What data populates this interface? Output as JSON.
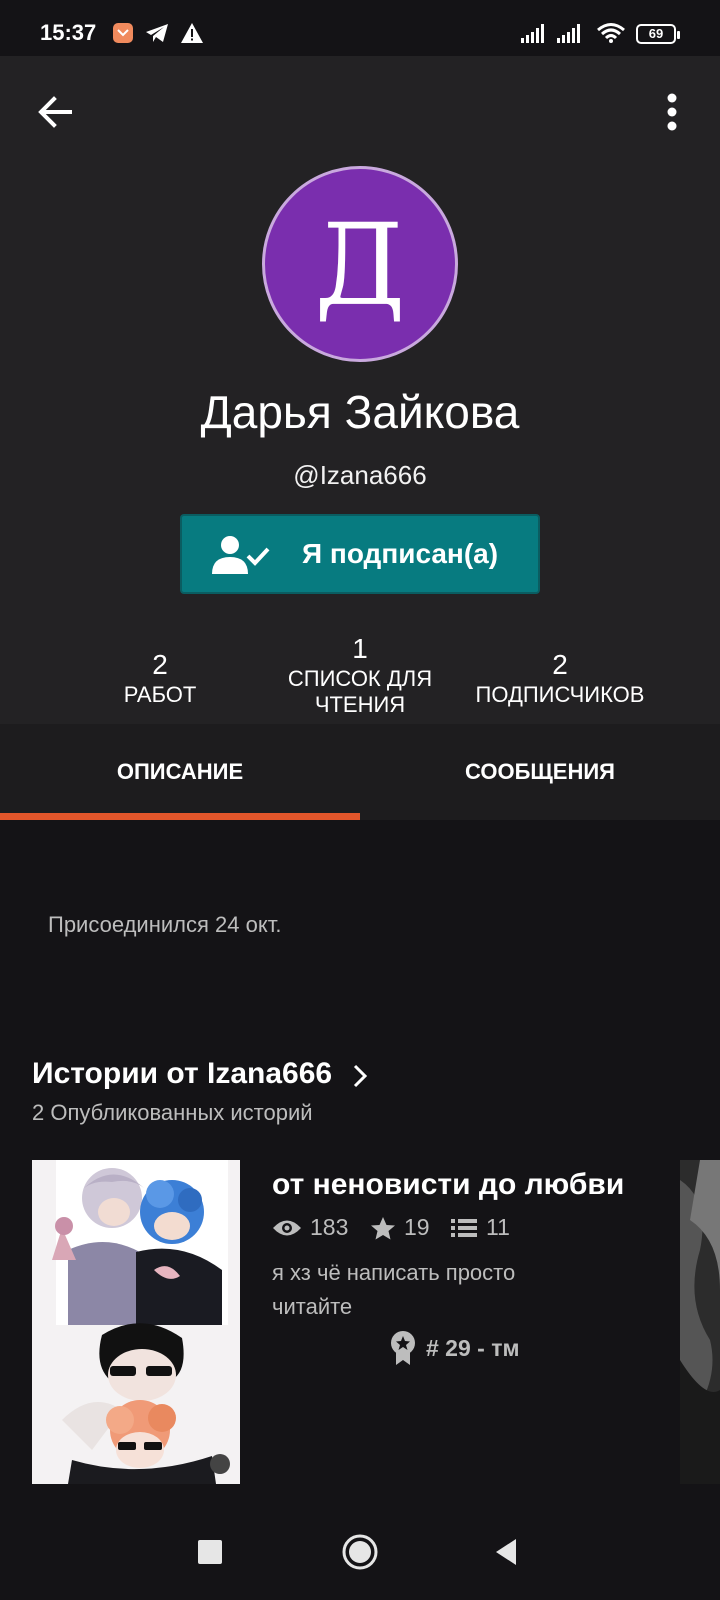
{
  "status_bar": {
    "time": "15:37",
    "battery": "69"
  },
  "profile": {
    "avatar_letter": "Д",
    "avatar_color": "#7a2eae",
    "name": "Дарья Зайкова",
    "username": "@Izana666",
    "follow_button_label": "Я подписан(а)",
    "follow_button_color": "#077b80"
  },
  "stats": [
    {
      "value": "2",
      "label": "РАБОТ"
    },
    {
      "value": "1",
      "label": "СПИСОК ДЛЯ ЧТЕНИЯ"
    },
    {
      "value": "2",
      "label": "ПОДПИСЧИКОВ"
    }
  ],
  "tabs": [
    {
      "label": "ОПИСАНИЕ",
      "active": true
    },
    {
      "label": "СООБЩЕНИЯ",
      "active": false
    }
  ],
  "accent_color": "#e2562b",
  "description": {
    "joined": "Присоединился 24 окт."
  },
  "stories": {
    "heading": "Истории от Izana666",
    "count_text": "2 Опубликованных историй",
    "items": [
      {
        "title": "от неновисти до любви",
        "reads": "183",
        "votes": "19",
        "parts": "11",
        "description": "я хз чё написать просто читайте",
        "rank": "# 29 - тм"
      }
    ]
  },
  "icons": {
    "back": "arrow-left-icon",
    "more": "more-vertical-icon",
    "follow": "user-check-icon",
    "reads": "eye-icon",
    "votes": "star-icon",
    "parts": "list-icon",
    "rank": "award-icon",
    "heading_chevron": "chevron-right-icon"
  }
}
